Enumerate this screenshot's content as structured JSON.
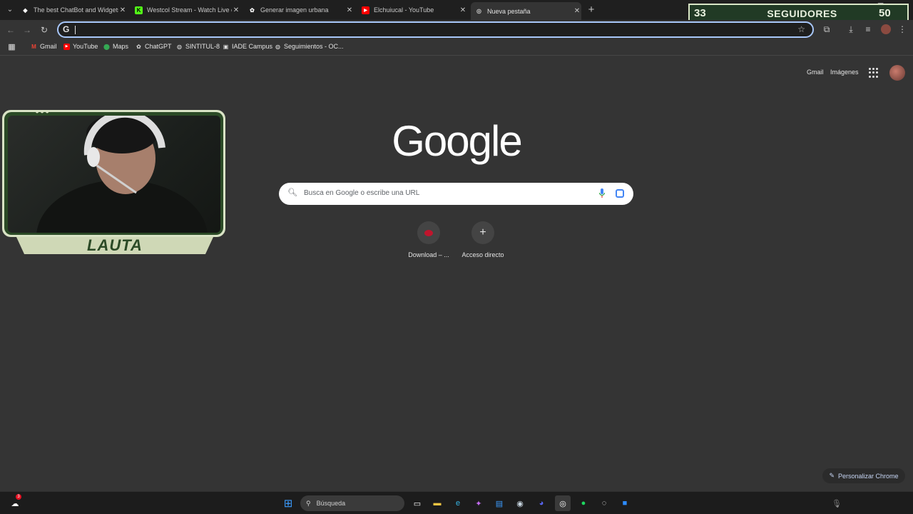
{
  "tabs": [
    {
      "title": "The best ChatBot and Widgets",
      "favicon": "chatbot-icon"
    },
    {
      "title": "Westcol Stream - Watch Live on",
      "favicon": "kick-icon"
    },
    {
      "title": "Generar imagen urbana",
      "favicon": "chatgpt-icon"
    },
    {
      "title": "Elchuiucal - YouTube",
      "favicon": "youtube-icon"
    },
    {
      "title": "Nueva pestaña",
      "favicon": "chrome-icon",
      "active": true
    }
  ],
  "followers": {
    "current": "33",
    "label": "SEGUIDORES",
    "goal": "50"
  },
  "omnibox": {
    "value": "",
    "g_glyph": "G"
  },
  "bookmarks": [
    {
      "label": "Gmail",
      "icon": "gmail-icon"
    },
    {
      "label": "YouTube",
      "icon": "youtube-icon"
    },
    {
      "label": "Maps",
      "icon": "maps-icon"
    },
    {
      "label": "ChatGPT",
      "icon": "chatgpt-icon"
    },
    {
      "label": "SINTITUL-8",
      "icon": "globe-icon"
    },
    {
      "label": "IADE Campus",
      "icon": "campus-icon"
    },
    {
      "label": "Seguimientos - OC...",
      "icon": "globe-icon"
    }
  ],
  "google": {
    "links": {
      "gmail": "Gmail",
      "images": "Imágenes"
    },
    "logo": "Google",
    "search_placeholder": "Busca en Google o escribe una URL",
    "shortcuts": [
      {
        "label": "Download – ...",
        "icon": "download-site-icon"
      },
      {
        "label": "Acceso directo",
        "icon": "plus-icon"
      }
    ],
    "customize_label": "Personalizar Chrome"
  },
  "webcam": {
    "name": "LAUTA"
  },
  "taskbar": {
    "search_label": "Búsqueda",
    "notification_count": "3",
    "icons": [
      "windows-start-icon",
      "search-icon",
      "task-view-icon",
      "file-explorer-icon",
      "edge-icon",
      "copilot-icon",
      "store-icon",
      "steam-icon",
      "discord-icon",
      "chrome-icon",
      "spotify-icon",
      "app-icon",
      "zoom-icon"
    ]
  },
  "colors": {
    "accent": "#a8c7fa",
    "overlay_green": "#213a25",
    "overlay_cream": "#d9e3c5"
  }
}
